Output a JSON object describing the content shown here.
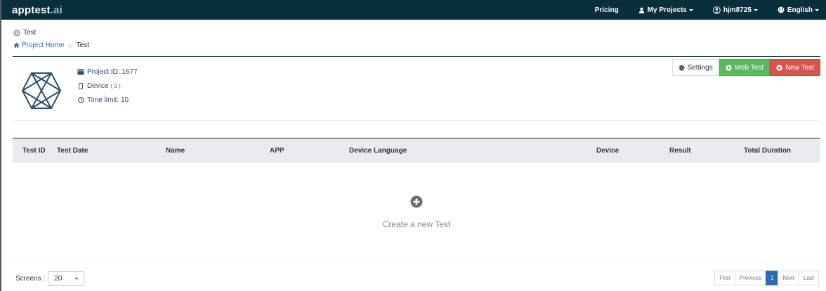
{
  "navbar": {
    "brand_main": "apptest",
    "brand_suffix": ".ai",
    "pricing": "Pricing",
    "projects": "My Projects",
    "user": "hjm8725",
    "language": "English"
  },
  "page": {
    "title": "Test"
  },
  "breadcrumb": {
    "home": "Project Home",
    "separator": "»",
    "current": "Test"
  },
  "project": {
    "id_label": "Project ID: 1677",
    "device_label": "Device",
    "device_count": "( 0 )",
    "time_limit_label": "Time limit: 10"
  },
  "actions": {
    "settings": "Settings",
    "web_test": "Web Test",
    "new_test": "New Test"
  },
  "table": {
    "columns": [
      "Test ID",
      "Test Date",
      "Name",
      "APP",
      "Device Language",
      "Device",
      "Result",
      "Total Duration"
    ]
  },
  "empty": {
    "text": "Create a new Test"
  },
  "footer": {
    "screens_label": "Screens :",
    "screens_value": "20",
    "pages": [
      "First",
      "Previous",
      "1",
      "Next",
      "Last"
    ]
  },
  "colors": {
    "navbar": "#0a2f3c",
    "link": "#2a6db5",
    "success": "#5cb85c",
    "danger": "#d9534f",
    "table_header": "#e8ebef"
  }
}
